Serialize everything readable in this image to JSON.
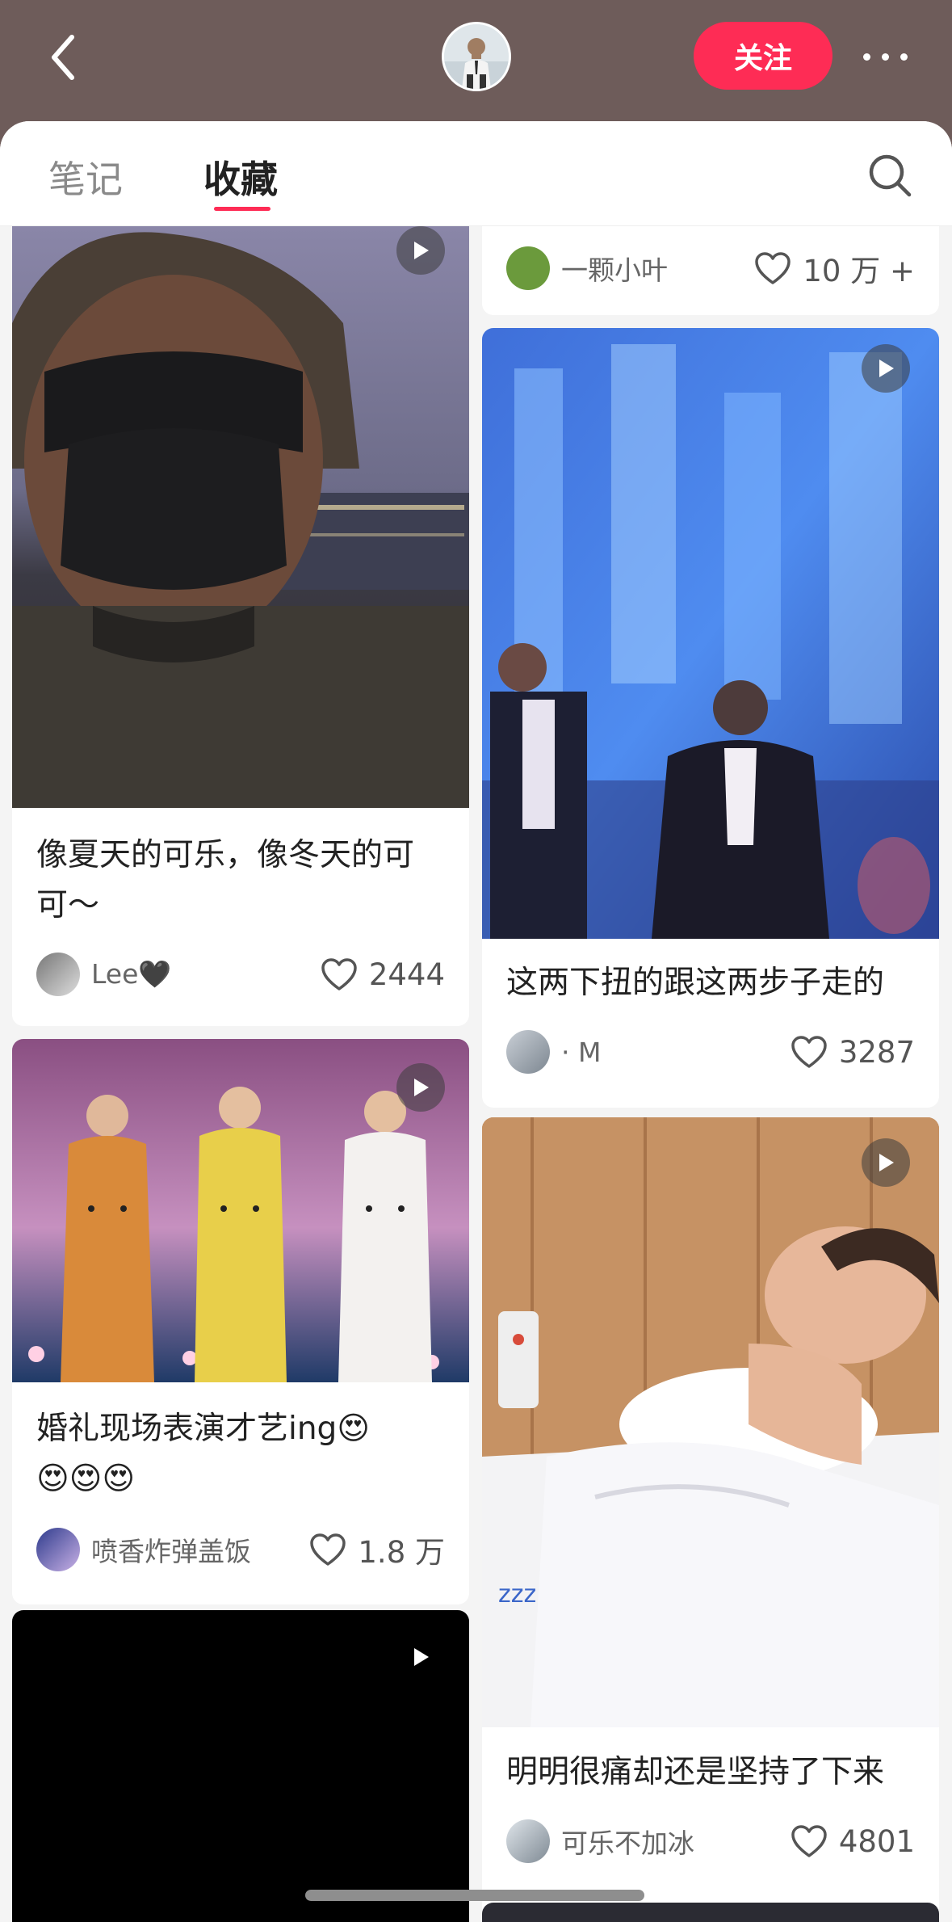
{
  "header": {
    "follow_label": "关注",
    "icons": {
      "back": "chevron-left-icon",
      "more": "more-dots-icon",
      "avatar": "profile-avatar"
    }
  },
  "tabs": [
    {
      "label": "笔记",
      "active": false
    },
    {
      "label": "收藏",
      "active": true
    }
  ],
  "accent_color": "#fe2c55",
  "feed": {
    "top_partial": {
      "author": "一颗小叶",
      "likes": "10 万 +"
    },
    "left_column": [
      {
        "title_lines": [
          "像夏天的可乐，像冬天的可",
          "可～"
        ],
        "author": "Lee🖤",
        "likes": "2444",
        "is_video": true
      },
      {
        "title_lines": [
          "婚礼现场表演才艺ing😍",
          "😍😍😍"
        ],
        "author": "喷香炸弹盖饭",
        "likes": "1.8 万",
        "is_video": true
      },
      {
        "title_lines": [],
        "author": "",
        "likes": "",
        "is_video": true
      }
    ],
    "right_column": [
      {
        "title_lines": [
          "这两下扭的跟这两步子走的"
        ],
        "author": "· M",
        "likes": "3287",
        "is_video": true
      },
      {
        "title_lines": [
          "明明很痛却还是坚持了下来"
        ],
        "author": "可乐不加冰",
        "likes": "4801",
        "is_video": true
      }
    ]
  }
}
